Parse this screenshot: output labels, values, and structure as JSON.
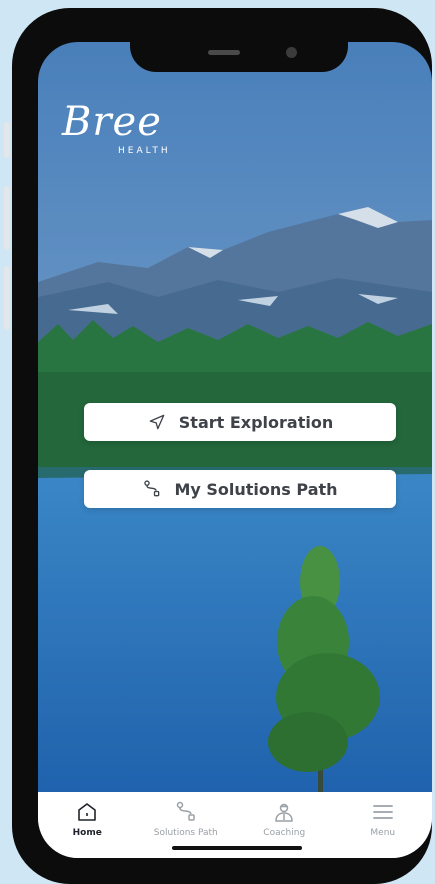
{
  "brand": {
    "script": "Bree",
    "sub": "HEALTH"
  },
  "actions": {
    "explore_label": "Start Exploration",
    "path_label": "My Solutions Path"
  },
  "tabs": [
    {
      "label": "Home",
      "icon": "home-icon",
      "active": true
    },
    {
      "label": "Solutions Path",
      "icon": "route-icon",
      "active": false
    },
    {
      "label": "Coaching",
      "icon": "coach-icon",
      "active": false
    },
    {
      "label": "Menu",
      "icon": "hamburger-menu-icon",
      "active": false
    }
  ],
  "colors": {
    "sky": "#6f9dcc",
    "lake": "#2f7cc8",
    "forest": "#2c7b3a",
    "tab_active": "#1f2329",
    "tab_inactive": "#9aa0a6"
  }
}
